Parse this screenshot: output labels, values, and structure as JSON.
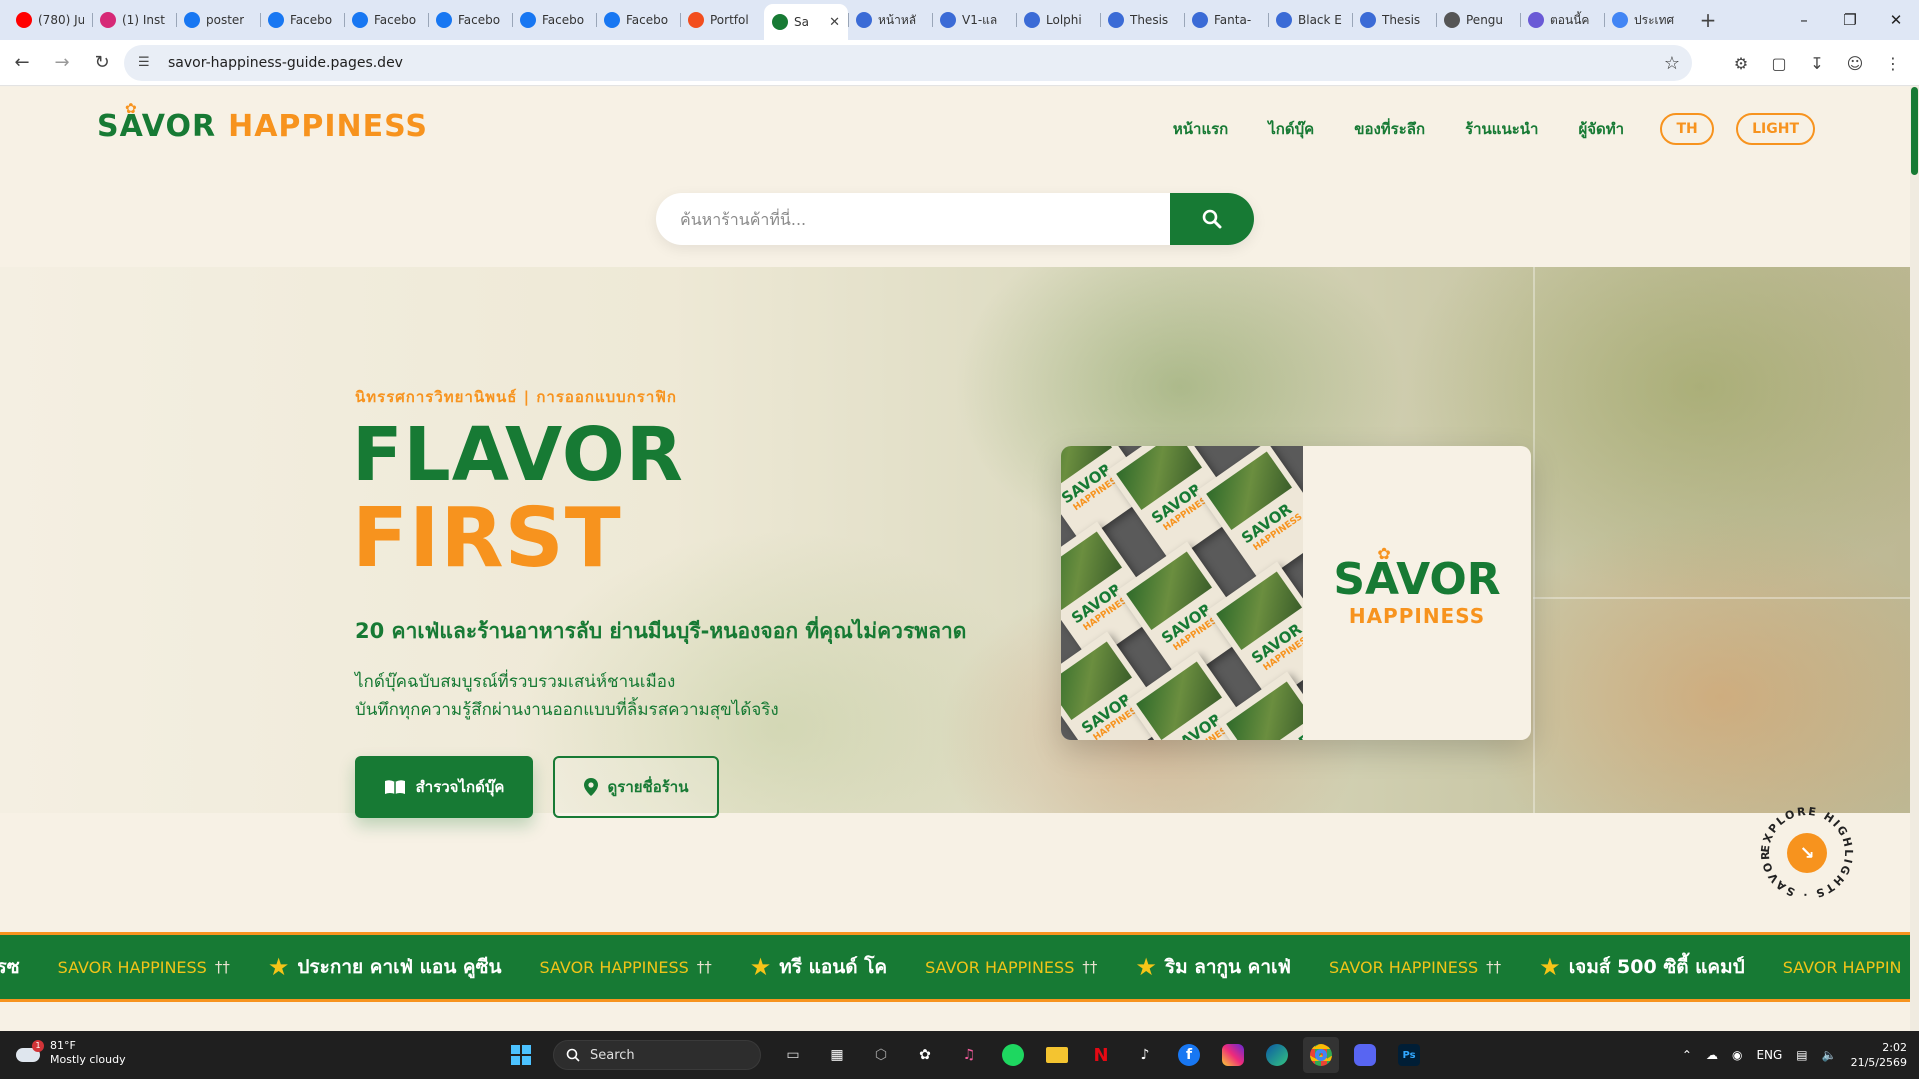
{
  "browser": {
    "tabs": [
      {
        "title": "(780) Ju",
        "icon": "youtube-icon",
        "color": "#ff0000"
      },
      {
        "title": "(1) Inst",
        "icon": "instagram-icon",
        "color": "#d62976"
      },
      {
        "title": "poster",
        "icon": "facebook-icon",
        "color": "#1877f2"
      },
      {
        "title": "Facebo",
        "icon": "facebook-icon",
        "color": "#1877f2"
      },
      {
        "title": "Facebo",
        "icon": "facebook-icon",
        "color": "#1877f2"
      },
      {
        "title": "Facebo",
        "icon": "facebook-icon",
        "color": "#1877f2"
      },
      {
        "title": "Facebo",
        "icon": "facebook-icon",
        "color": "#1877f2"
      },
      {
        "title": "Facebo",
        "icon": "facebook-icon",
        "color": "#1877f2"
      },
      {
        "title": "Portfol",
        "icon": "figma-icon",
        "color": "#f24e1e"
      },
      {
        "title": "Sa",
        "icon": "site-icon",
        "color": "#177a34",
        "active": true
      },
      {
        "title": "หน้าหลั",
        "icon": "globe-icon",
        "color": "#3b6bd6"
      },
      {
        "title": "V1-แล",
        "icon": "globe-icon",
        "color": "#3b6bd6"
      },
      {
        "title": "Lolphi",
        "icon": "globe-icon",
        "color": "#3b6bd6"
      },
      {
        "title": "Thesis",
        "icon": "globe-icon",
        "color": "#3b6bd6"
      },
      {
        "title": "Fanta-",
        "icon": "globe-icon",
        "color": "#3b6bd6"
      },
      {
        "title": "Black E",
        "icon": "globe-icon",
        "color": "#3b6bd6"
      },
      {
        "title": "Thesis",
        "icon": "globe-icon",
        "color": "#3b6bd6"
      },
      {
        "title": "Pengu",
        "icon": "penguin-icon",
        "color": "#555555"
      },
      {
        "title": "ตอนนี้ค",
        "icon": "gemini-icon",
        "color": "#6a5ad6"
      },
      {
        "title": "ประเทศ",
        "icon": "google-icon",
        "color": "#4285f4"
      }
    ],
    "url": "savor-happiness-guide.pages.dev"
  },
  "site": {
    "logo_main": "SAVOR",
    "logo_accent": "HAPPINESS",
    "nav": [
      "หน้าแรก",
      "ไกด์บุ๊ค",
      "ของที่ระลึก",
      "ร้านแนะนำ",
      "ผู้จัดทำ"
    ],
    "lang_toggle": "TH",
    "theme_toggle": "LIGHT",
    "search_placeholder": "ค้นหาร้านค้าที่นี่..."
  },
  "hero": {
    "eyebrow": "นิทรรศการวิทยานิพนธ์ | การออกแบบกราฟิก",
    "title_1": "FLAVOR",
    "title_2": "FIRST",
    "subtitle": "20 คาเฟ่และร้านอาหารลับ ย่านมีนบุรี-หนองจอก ที่คุณไม่ควรพลาด",
    "desc_1": "ไกด์บุ๊คฉบับสมบูรณ์ที่รวบรวมเสน่ห์ชานเมือง",
    "desc_2": "บันทึกทุกความรู้สึกผ่านงานออกแบบที่ลิ้มรสความสุขได้จริง",
    "btn_primary": "สำรวจไกด์บุ๊ค",
    "btn_secondary": "ดูรายชื่อร้าน",
    "card_brand_main": "SAVOR",
    "card_brand_accent": "HAPPINESS",
    "explore_text": "EXPLORE HIGHLIGHTS · SAVOR ·"
  },
  "ticker": {
    "brand": "SAVOR HAPPINESS",
    "leading_fragment": "เรซ",
    "shops": [
      "ประกาย คาเฟ่ แอน คูซีน",
      "ทรี แอนด์ โค",
      "ริม ลากูน คาเฟ่",
      "เจมส์ 500 ซิตี้ แคมป์"
    ],
    "trailing_fragment": "SAVOR HAPPIN"
  },
  "taskbar": {
    "weather_temp": "81°F",
    "weather_desc": "Mostly cloudy",
    "weather_badge": "1",
    "search_label": "Search",
    "lang": "ENG",
    "time": "2:02",
    "date": "21/5/2569"
  },
  "colors": {
    "green": "#177a34",
    "orange": "#f7931e",
    "cream": "#f7f1e5"
  }
}
